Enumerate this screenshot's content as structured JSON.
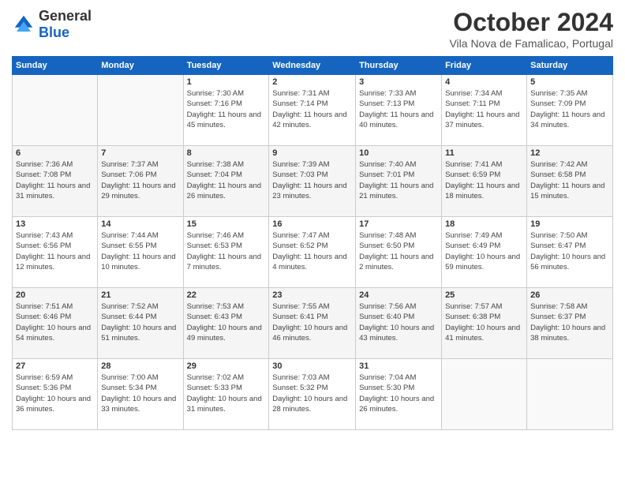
{
  "header": {
    "logo": {
      "general": "General",
      "blue": "Blue"
    },
    "title": "October 2024",
    "location": "Vila Nova de Famalicao, Portugal"
  },
  "weekdays": [
    "Sunday",
    "Monday",
    "Tuesday",
    "Wednesday",
    "Thursday",
    "Friday",
    "Saturday"
  ],
  "weeks": [
    [
      {
        "day": "",
        "sunrise": "",
        "sunset": "",
        "daylight": ""
      },
      {
        "day": "",
        "sunrise": "",
        "sunset": "",
        "daylight": ""
      },
      {
        "day": "1",
        "sunrise": "Sunrise: 7:30 AM",
        "sunset": "Sunset: 7:16 PM",
        "daylight": "Daylight: 11 hours and 45 minutes."
      },
      {
        "day": "2",
        "sunrise": "Sunrise: 7:31 AM",
        "sunset": "Sunset: 7:14 PM",
        "daylight": "Daylight: 11 hours and 42 minutes."
      },
      {
        "day": "3",
        "sunrise": "Sunrise: 7:33 AM",
        "sunset": "Sunset: 7:13 PM",
        "daylight": "Daylight: 11 hours and 40 minutes."
      },
      {
        "day": "4",
        "sunrise": "Sunrise: 7:34 AM",
        "sunset": "Sunset: 7:11 PM",
        "daylight": "Daylight: 11 hours and 37 minutes."
      },
      {
        "day": "5",
        "sunrise": "Sunrise: 7:35 AM",
        "sunset": "Sunset: 7:09 PM",
        "daylight": "Daylight: 11 hours and 34 minutes."
      }
    ],
    [
      {
        "day": "6",
        "sunrise": "Sunrise: 7:36 AM",
        "sunset": "Sunset: 7:08 PM",
        "daylight": "Daylight: 11 hours and 31 minutes."
      },
      {
        "day": "7",
        "sunrise": "Sunrise: 7:37 AM",
        "sunset": "Sunset: 7:06 PM",
        "daylight": "Daylight: 11 hours and 29 minutes."
      },
      {
        "day": "8",
        "sunrise": "Sunrise: 7:38 AM",
        "sunset": "Sunset: 7:04 PM",
        "daylight": "Daylight: 11 hours and 26 minutes."
      },
      {
        "day": "9",
        "sunrise": "Sunrise: 7:39 AM",
        "sunset": "Sunset: 7:03 PM",
        "daylight": "Daylight: 11 hours and 23 minutes."
      },
      {
        "day": "10",
        "sunrise": "Sunrise: 7:40 AM",
        "sunset": "Sunset: 7:01 PM",
        "daylight": "Daylight: 11 hours and 21 minutes."
      },
      {
        "day": "11",
        "sunrise": "Sunrise: 7:41 AM",
        "sunset": "Sunset: 6:59 PM",
        "daylight": "Daylight: 11 hours and 18 minutes."
      },
      {
        "day": "12",
        "sunrise": "Sunrise: 7:42 AM",
        "sunset": "Sunset: 6:58 PM",
        "daylight": "Daylight: 11 hours and 15 minutes."
      }
    ],
    [
      {
        "day": "13",
        "sunrise": "Sunrise: 7:43 AM",
        "sunset": "Sunset: 6:56 PM",
        "daylight": "Daylight: 11 hours and 12 minutes."
      },
      {
        "day": "14",
        "sunrise": "Sunrise: 7:44 AM",
        "sunset": "Sunset: 6:55 PM",
        "daylight": "Daylight: 11 hours and 10 minutes."
      },
      {
        "day": "15",
        "sunrise": "Sunrise: 7:46 AM",
        "sunset": "Sunset: 6:53 PM",
        "daylight": "Daylight: 11 hours and 7 minutes."
      },
      {
        "day": "16",
        "sunrise": "Sunrise: 7:47 AM",
        "sunset": "Sunset: 6:52 PM",
        "daylight": "Daylight: 11 hours and 4 minutes."
      },
      {
        "day": "17",
        "sunrise": "Sunrise: 7:48 AM",
        "sunset": "Sunset: 6:50 PM",
        "daylight": "Daylight: 11 hours and 2 minutes."
      },
      {
        "day": "18",
        "sunrise": "Sunrise: 7:49 AM",
        "sunset": "Sunset: 6:49 PM",
        "daylight": "Daylight: 10 hours and 59 minutes."
      },
      {
        "day": "19",
        "sunrise": "Sunrise: 7:50 AM",
        "sunset": "Sunset: 6:47 PM",
        "daylight": "Daylight: 10 hours and 56 minutes."
      }
    ],
    [
      {
        "day": "20",
        "sunrise": "Sunrise: 7:51 AM",
        "sunset": "Sunset: 6:46 PM",
        "daylight": "Daylight: 10 hours and 54 minutes."
      },
      {
        "day": "21",
        "sunrise": "Sunrise: 7:52 AM",
        "sunset": "Sunset: 6:44 PM",
        "daylight": "Daylight: 10 hours and 51 minutes."
      },
      {
        "day": "22",
        "sunrise": "Sunrise: 7:53 AM",
        "sunset": "Sunset: 6:43 PM",
        "daylight": "Daylight: 10 hours and 49 minutes."
      },
      {
        "day": "23",
        "sunrise": "Sunrise: 7:55 AM",
        "sunset": "Sunset: 6:41 PM",
        "daylight": "Daylight: 10 hours and 46 minutes."
      },
      {
        "day": "24",
        "sunrise": "Sunrise: 7:56 AM",
        "sunset": "Sunset: 6:40 PM",
        "daylight": "Daylight: 10 hours and 43 minutes."
      },
      {
        "day": "25",
        "sunrise": "Sunrise: 7:57 AM",
        "sunset": "Sunset: 6:38 PM",
        "daylight": "Daylight: 10 hours and 41 minutes."
      },
      {
        "day": "26",
        "sunrise": "Sunrise: 7:58 AM",
        "sunset": "Sunset: 6:37 PM",
        "daylight": "Daylight: 10 hours and 38 minutes."
      }
    ],
    [
      {
        "day": "27",
        "sunrise": "Sunrise: 6:59 AM",
        "sunset": "Sunset: 5:36 PM",
        "daylight": "Daylight: 10 hours and 36 minutes."
      },
      {
        "day": "28",
        "sunrise": "Sunrise: 7:00 AM",
        "sunset": "Sunset: 5:34 PM",
        "daylight": "Daylight: 10 hours and 33 minutes."
      },
      {
        "day": "29",
        "sunrise": "Sunrise: 7:02 AM",
        "sunset": "Sunset: 5:33 PM",
        "daylight": "Daylight: 10 hours and 31 minutes."
      },
      {
        "day": "30",
        "sunrise": "Sunrise: 7:03 AM",
        "sunset": "Sunset: 5:32 PM",
        "daylight": "Daylight: 10 hours and 28 minutes."
      },
      {
        "day": "31",
        "sunrise": "Sunrise: 7:04 AM",
        "sunset": "Sunset: 5:30 PM",
        "daylight": "Daylight: 10 hours and 26 minutes."
      },
      {
        "day": "",
        "sunrise": "",
        "sunset": "",
        "daylight": ""
      },
      {
        "day": "",
        "sunrise": "",
        "sunset": "",
        "daylight": ""
      }
    ]
  ]
}
